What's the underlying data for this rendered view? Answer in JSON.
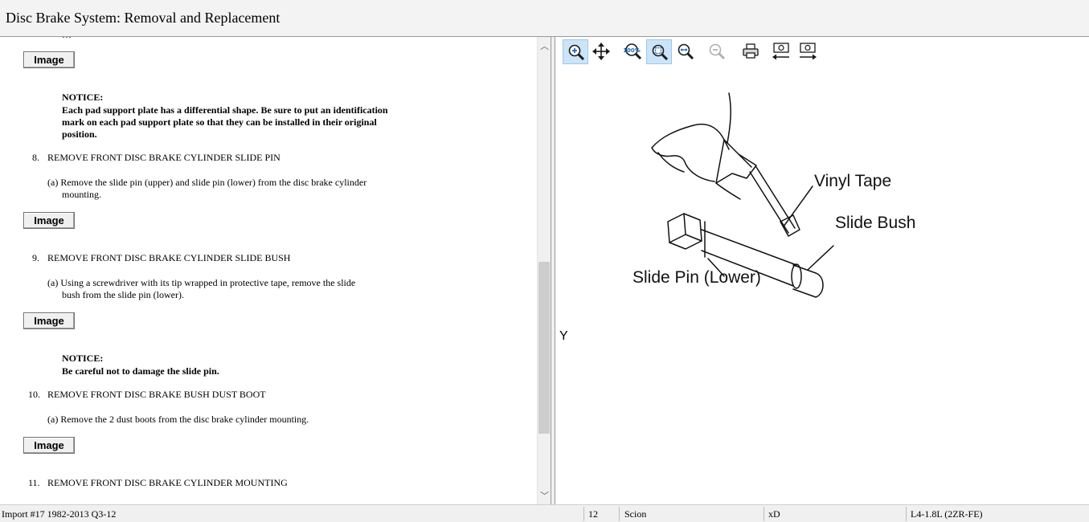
{
  "window": {
    "title": "Disc Brake System:  Removal and Replacement"
  },
  "procedure": {
    "image_button_label": "Image",
    "notice_1": {
      "heading": "NOTICE:",
      "lines": [
        "Each pad support plate has a differential shape. Be sure to put an identification",
        "mark on each pad support plate so that they can be installed in their original",
        "position."
      ]
    },
    "step_8": {
      "number": "8.",
      "title": "REMOVE FRONT DISC BRAKE CYLINDER SLIDE PIN",
      "sub": [
        "(a) Remove the slide pin (upper) and slide pin (lower) from the disc brake cylinder",
        "mounting."
      ]
    },
    "step_9": {
      "number": "9.",
      "title": "REMOVE FRONT DISC BRAKE CYLINDER SLIDE BUSH",
      "sub": [
        "(a) Using a screwdriver with its tip wrapped in protective tape, remove the slide",
        "bush from the slide pin (lower)."
      ]
    },
    "notice_2": {
      "heading": "NOTICE:",
      "text": "Be careful not to damage the slide pin."
    },
    "step_10": {
      "number": "10.",
      "title": "REMOVE FRONT DISC BRAKE BUSH DUST BOOT",
      "sub": "(a) Remove the 2 dust boots from the disc brake cylinder mounting."
    },
    "step_11": {
      "number": "11.",
      "title": "REMOVE FRONT DISC BRAKE CYLINDER MOUNTING"
    }
  },
  "toolbar": {
    "buttons": [
      {
        "icon": "zoom-in-tool-icon",
        "active": true
      },
      {
        "icon": "pan-move-icon",
        "active": false
      },
      {
        "icon": "actual-size-icon",
        "active": false
      },
      {
        "icon": "zoom-fit-icon",
        "active": true
      },
      {
        "icon": "zoom-width-icon",
        "active": false
      },
      {
        "icon": "zoom-out-icon",
        "active": false
      },
      {
        "icon": "print-icon",
        "active": false
      },
      {
        "icon": "previous-image-icon",
        "active": false
      },
      {
        "icon": "next-image-icon",
        "active": false
      }
    ],
    "actual_size_glyph": "100%"
  },
  "illustration": {
    "labels": {
      "vinyl_tape": "Vinyl Tape",
      "slide_bush": "Slide Bush",
      "slide_pin": "Slide Pin (Lower)"
    },
    "corner_letter": "Y"
  },
  "status": {
    "source": "Import #17 1982-2013 Q3-12",
    "year": "12",
    "make": "Scion",
    "model": "xD",
    "engine": "L4-1.8L (2ZR-FE)"
  },
  "colors": {
    "toolbar_active": "#cce4f7",
    "icon_blue": "#1f6fbf",
    "background": "#ffffff"
  }
}
